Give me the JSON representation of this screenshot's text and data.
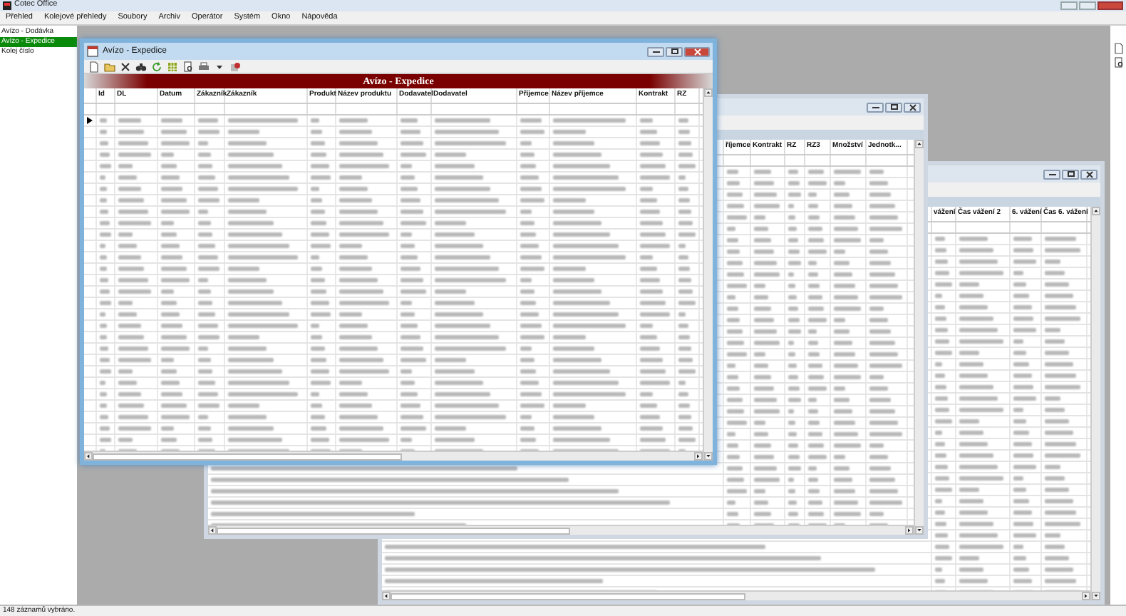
{
  "app_title": "Cotec Office",
  "menu": [
    "Přehled",
    "Kolejové přehledy",
    "Soubory",
    "Archiv",
    "Operátor",
    "Systém",
    "Okno",
    "Nápověda"
  ],
  "sidebar": {
    "items": [
      {
        "label": "Avízo - Dodávka",
        "selected": false
      },
      {
        "label": "Avízo - Expedice",
        "selected": true
      },
      {
        "label": "Kolej číslo",
        "selected": false
      }
    ]
  },
  "windows": [
    {
      "title": "Avízo - Expedice",
      "active": true,
      "banner": "Avízo - Expedice",
      "columns": [
        "Id",
        "DL",
        "Datum",
        "Zákazník",
        "Zákazník",
        "Produkt",
        "Název produktu",
        "Dodavatel",
        "Dodavatel",
        "Příjemce",
        "Název příjemce",
        "Kontrakt",
        "RZ"
      ]
    },
    {
      "active": false,
      "columns": [
        "říjemce",
        "Kontrakt",
        "RZ",
        "RZ3",
        "Množství",
        "Jednotk..."
      ]
    },
    {
      "active": false,
      "columns": [
        "vážení",
        "Čas vážení 2",
        "6. vážení",
        "Čas 6. vážení"
      ]
    }
  ],
  "status_bar": "148 záznamů vybráno."
}
